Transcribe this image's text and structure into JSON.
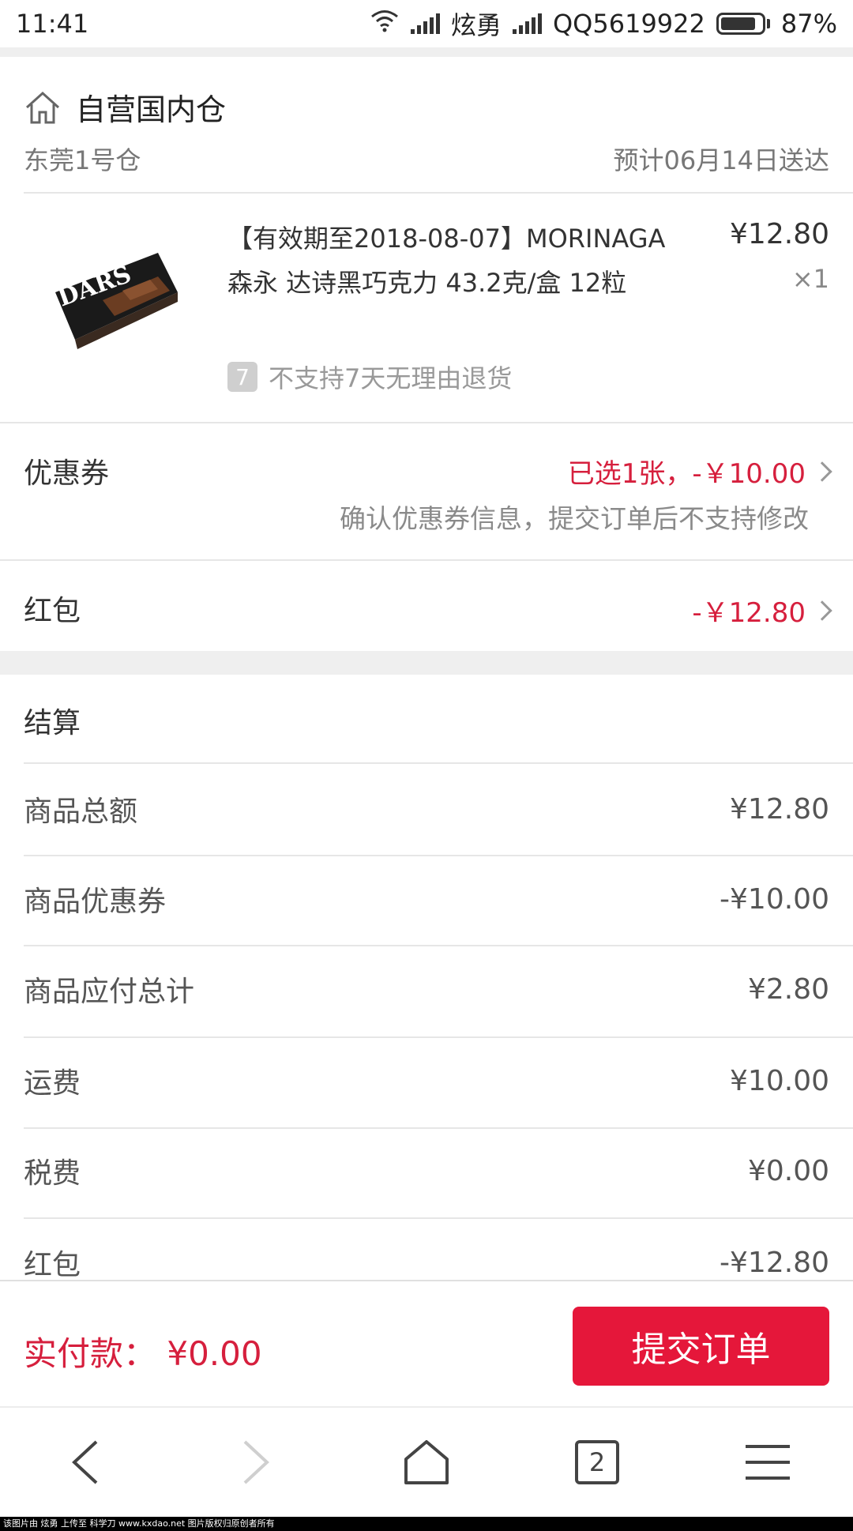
{
  "status_bar": {
    "time": "11:41",
    "carrier1": "炫勇",
    "carrier2": "QQ5619922",
    "battery": "87%",
    "battery_level": 0.87
  },
  "warehouse": {
    "title": "自营国内仓",
    "name": "东莞1号仓",
    "eta": "预计06月14日送达"
  },
  "product": {
    "image_text": "DARS",
    "name": "【有效期至2018-08-07】MORINAGA 森永 达诗黑巧克力 43.2克/盒 12粒",
    "price": "¥12.80",
    "qty": "×1",
    "return_badge": "7",
    "return_policy": "不支持7天无理由退货"
  },
  "coupon": {
    "label": "优惠券",
    "value": "已选1张，-￥10.00",
    "note": "确认优惠券信息，提交订单后不支持修改"
  },
  "red_packet": {
    "label": "红包",
    "value": "-￥12.80"
  },
  "settlement": {
    "title": "结算",
    "rows": [
      {
        "label": "商品总额",
        "value": "¥12.80"
      },
      {
        "label": "商品优惠券",
        "value": "-¥10.00"
      },
      {
        "label": "商品应付总计",
        "value": "¥2.80"
      },
      {
        "label": "运费",
        "value": "¥10.00"
      },
      {
        "label": "税费",
        "value": "¥0.00"
      },
      {
        "label": "红包",
        "value": "-¥12.80"
      }
    ]
  },
  "bottom": {
    "pay_label": "实付款：  ¥0.00",
    "submit_label": "提交订单"
  },
  "nav": {
    "tabs_count": "2"
  },
  "watermark": "该图片由 炫勇 上传至 科学刀 www.kxdao.net 图片版权归原创者所有",
  "colors": {
    "accent": "#e5173a",
    "price_red": "#d61f3d"
  }
}
